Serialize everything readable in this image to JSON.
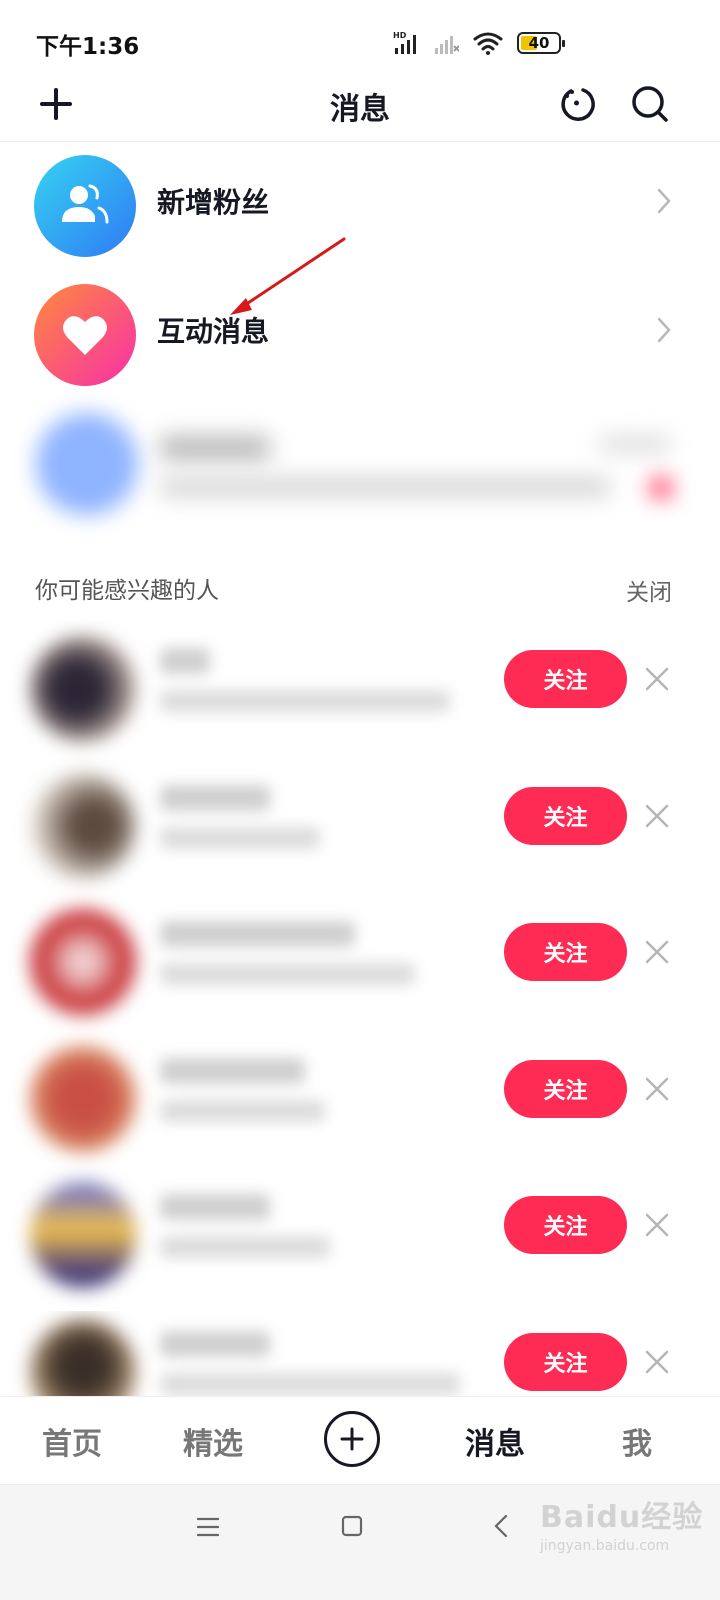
{
  "status_bar": {
    "time": "下午1:36",
    "battery": "40",
    "battery_color": "#f0c400"
  },
  "header": {
    "title": "消息",
    "left_icon": "plus-icon",
    "right_icons": [
      "refresh-icon",
      "search-icon"
    ]
  },
  "notifications": [
    {
      "label": "新增粉丝",
      "icon": "fans-icon",
      "gradient": [
        "#36d3f2",
        "#2f7af3"
      ]
    },
    {
      "label": "互动消息",
      "icon": "heart-icon",
      "gradient": [
        "#ff8a3d",
        "#f72fa8"
      ]
    }
  ],
  "suggestions": {
    "title": "你可能感兴趣的人",
    "close_label": "关闭",
    "follow_label": "关注",
    "follow_color": "#fe2c55",
    "count": 6
  },
  "bottom_nav": {
    "items": [
      "首页",
      "精选",
      "消息",
      "我"
    ],
    "active": "消息",
    "center_icon": "plus-circle-icon"
  },
  "system_nav": {
    "icons": [
      "menu-icon",
      "home-icon",
      "back-icon"
    ]
  },
  "watermark": {
    "text": "Baidu经验",
    "url": "jingyan.baidu.com"
  },
  "annotation": {
    "arrow_color": "#d81818"
  }
}
